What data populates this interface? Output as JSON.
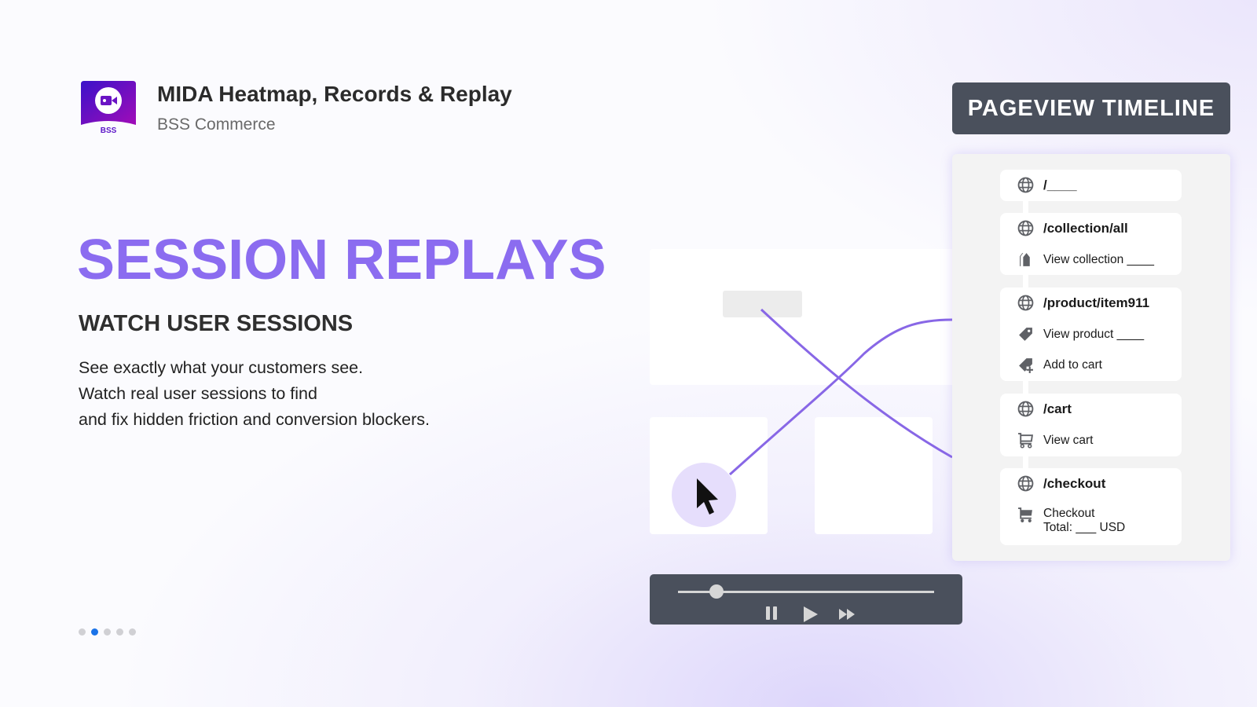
{
  "app": {
    "title": "MIDA Heatmap, Records & Replay",
    "vendor": "BSS Commerce",
    "logo_text": "BSS",
    "logo_colors": [
      "#3a12c9",
      "#a10cb8"
    ]
  },
  "hero": {
    "headline": "SESSION REPLAYS",
    "subhead": "WATCH USER SESSIONS",
    "body_lines": [
      "See exactly what your customers see.",
      "Watch real user sessions to find",
      "and fix hidden friction and conversion blockers."
    ],
    "accent_color": "#8b6cf0"
  },
  "carousel": {
    "count": 5,
    "active_index": 1,
    "active_color": "#1a73e8"
  },
  "timeline": {
    "label": "PAGEVIEW TIMELINE",
    "entries": [
      {
        "path": "/____",
        "events": []
      },
      {
        "path": "/collection/all",
        "events": [
          {
            "icon": "collection-tags-icon",
            "text": "View collection ____"
          }
        ]
      },
      {
        "path": "/product/item911",
        "events": [
          {
            "icon": "tag-icon",
            "text": "View product ____"
          },
          {
            "icon": "tag-plus-icon",
            "text": "Add to cart"
          }
        ]
      },
      {
        "path": "/cart",
        "events": [
          {
            "icon": "cart-outline-icon",
            "text": "View cart"
          }
        ]
      },
      {
        "path": "/checkout",
        "events": [
          {
            "icon": "cart-filled-icon",
            "text": "Checkout",
            "text2": "Total: ___ USD"
          }
        ]
      }
    ]
  },
  "player": {
    "progress": 0.15,
    "controls": [
      "pause",
      "play",
      "fast-forward"
    ]
  }
}
